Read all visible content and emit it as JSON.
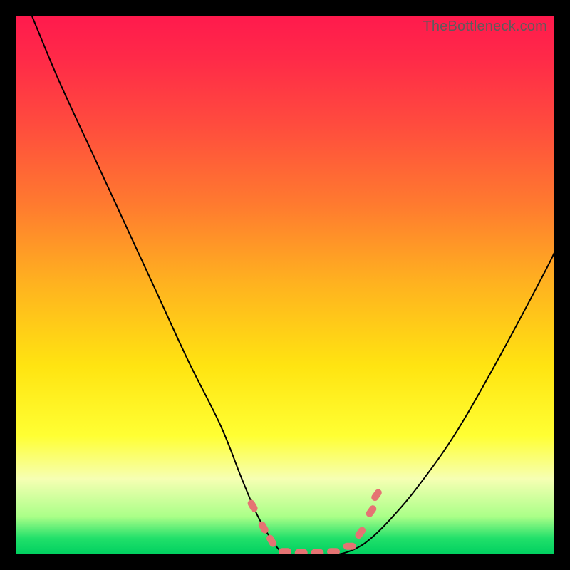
{
  "watermark": "TheBottleneck.com",
  "chart_data": {
    "type": "line",
    "title": "",
    "xlabel": "",
    "ylabel": "",
    "xlim": [
      0,
      100
    ],
    "ylim": [
      0,
      100
    ],
    "gradient_stops": [
      {
        "pos": 0,
        "color": "#ff1a4d"
      },
      {
        "pos": 20,
        "color": "#ff4b3e"
      },
      {
        "pos": 50,
        "color": "#ffb31f"
      },
      {
        "pos": 78,
        "color": "#ffff33"
      },
      {
        "pos": 97,
        "color": "#22e06a"
      },
      {
        "pos": 100,
        "color": "#00d060"
      }
    ],
    "series": [
      {
        "name": "left-curve",
        "x": [
          3,
          8,
          14,
          20,
          26,
          32,
          38,
          42,
          45,
          48,
          50,
          52
        ],
        "y": [
          100,
          88,
          75,
          62,
          49,
          36,
          24,
          14,
          7,
          2,
          0,
          0
        ]
      },
      {
        "name": "right-curve",
        "x": [
          58,
          60,
          63,
          66,
          70,
          75,
          82,
          90,
          98,
          100
        ],
        "y": [
          0,
          0,
          1,
          3,
          7,
          13,
          23,
          37,
          52,
          56
        ]
      }
    ],
    "markers": [
      {
        "x": 44,
        "y": 9
      },
      {
        "x": 46,
        "y": 5
      },
      {
        "x": 47.5,
        "y": 2.5
      },
      {
        "x": 50,
        "y": 0.5
      },
      {
        "x": 53,
        "y": 0.3
      },
      {
        "x": 56,
        "y": 0.3
      },
      {
        "x": 59,
        "y": 0.5
      },
      {
        "x": 62,
        "y": 1.5
      },
      {
        "x": 64,
        "y": 4
      },
      {
        "x": 66,
        "y": 8
      },
      {
        "x": 67,
        "y": 11
      }
    ]
  }
}
